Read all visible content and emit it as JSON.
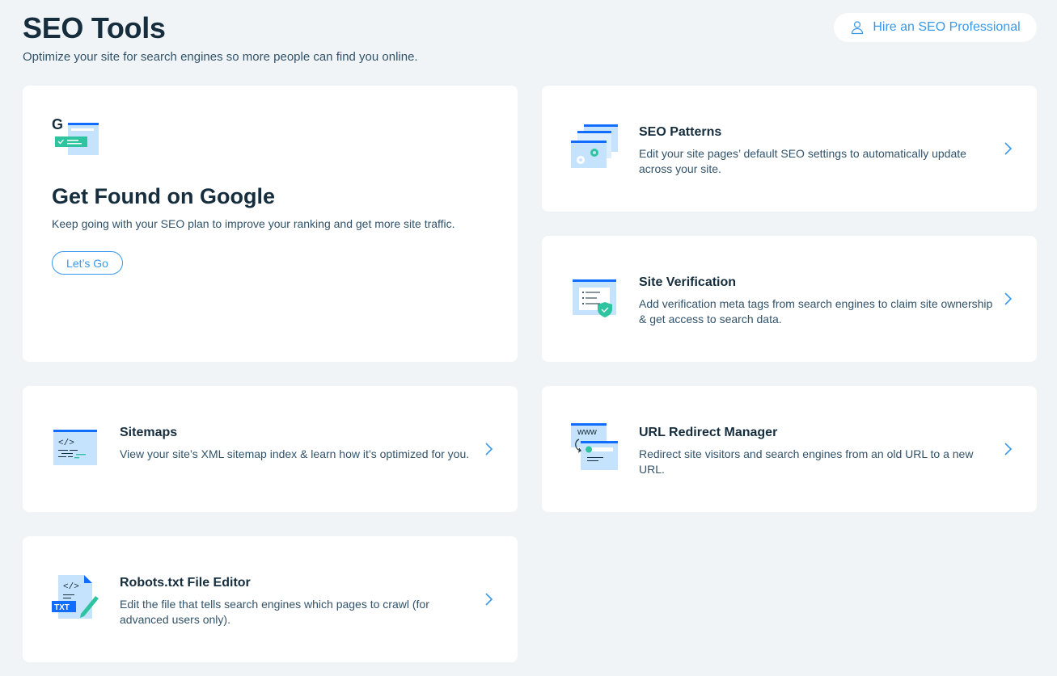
{
  "header": {
    "title": "SEO Tools",
    "subtitle": "Optimize your site for search engines so more people can find you online.",
    "hire_button_label": "Hire an SEO Professional"
  },
  "hero": {
    "title": "Get Found on Google",
    "description": "Keep going with your SEO plan to improve your ranking and get more site traffic.",
    "button_label": "Let’s Go",
    "icon": "google-search-result-icon"
  },
  "tools": {
    "patterns": {
      "title": "SEO Patterns",
      "description": "Edit your site pages’ default SEO settings to automatically update across your site.",
      "icon": "seo-patterns-icon"
    },
    "verification": {
      "title": "Site Verification",
      "description": "Add verification meta tags from search engines to claim site ownership & get access to search data.",
      "icon": "site-verification-icon"
    },
    "sitemaps": {
      "title": "Sitemaps",
      "description": "View your site’s XML sitemap index & learn how it’s optimized for you.",
      "icon": "sitemap-code-icon"
    },
    "redirect": {
      "title": "URL Redirect Manager",
      "description": "Redirect site visitors and search engines from an old URL to a new URL.",
      "icon": "url-redirect-icon"
    },
    "robots": {
      "title": "Robots.txt File Editor",
      "description": "Edit the file that tells search engines which pages to crawl (for advanced users only).",
      "icon": "robots-txt-file-icon"
    }
  },
  "icon_text": {
    "google_letter": "G",
    "www": "www",
    "txt": "TXT",
    "code": "</>"
  },
  "colors": {
    "background": "#f0f4f7",
    "card": "#ffffff",
    "accent_blue": "#3899ec",
    "dark_text": "#162d3d",
    "body_text": "#32536a",
    "icon_light_blue": "#c6e3fd",
    "icon_blue": "#116dff",
    "icon_green": "#2ec4a0"
  }
}
